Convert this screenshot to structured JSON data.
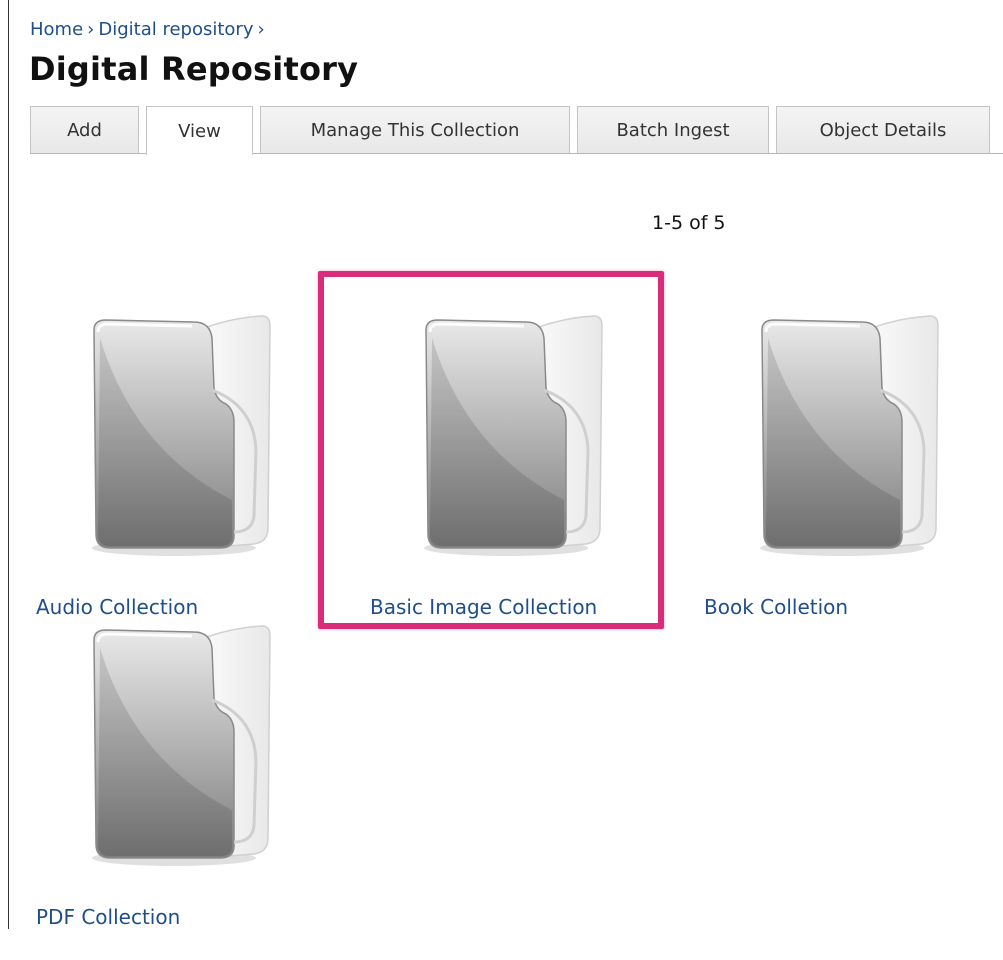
{
  "breadcrumb": {
    "items": [
      "Home",
      "Digital repository"
    ],
    "separator": "›"
  },
  "page_title": "Digital Repository",
  "tabs": [
    {
      "label": "Add",
      "active": false
    },
    {
      "label": "View",
      "active": true
    },
    {
      "label": "Manage This Collection",
      "active": false
    },
    {
      "label": "Batch Ingest",
      "active": false
    },
    {
      "label": "Object Details",
      "active": false
    }
  ],
  "pager": {
    "text": "1-5 of 5"
  },
  "collections": [
    {
      "label": "Audio Collection",
      "icon": "folder-icon"
    },
    {
      "label": "Basic Image Collection",
      "icon": "folder-icon",
      "highlighted": true
    },
    {
      "label": "Book Colletion",
      "icon": "folder-icon"
    },
    {
      "label": "PDF Collection",
      "icon": "folder-icon"
    }
  ],
  "colors": {
    "link": "#1f4e8c",
    "highlight": "#d92d7b"
  }
}
